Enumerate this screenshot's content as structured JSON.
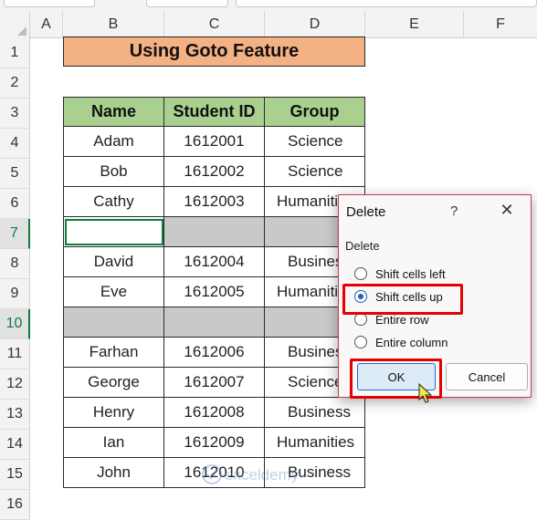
{
  "columns": [
    "A",
    "B",
    "C",
    "D",
    "E",
    "F"
  ],
  "rows": [
    "1",
    "2",
    "3",
    "4",
    "5",
    "6",
    "7",
    "8",
    "9",
    "10",
    "11",
    "12",
    "13",
    "14",
    "15",
    "16"
  ],
  "sheet": {
    "title": "Using Goto Feature",
    "headers": [
      "Name",
      "Student ID",
      "Group"
    ],
    "data_rows": [
      {
        "row": "4",
        "name": "Adam",
        "id": "1612001",
        "group": "Science"
      },
      {
        "row": "5",
        "name": "Bob",
        "id": "1612002",
        "group": "Science"
      },
      {
        "row": "6",
        "name": "Cathy",
        "id": "1612003",
        "group": "Humanities"
      },
      {
        "row": "8",
        "name": "David",
        "id": "1612004",
        "group": "Business"
      },
      {
        "row": "9",
        "name": "Eve",
        "id": "1612005",
        "group": "Humanities"
      },
      {
        "row": "11",
        "name": "Farhan",
        "id": "1612006",
        "group": "Business"
      },
      {
        "row": "12",
        "name": "George",
        "id": "1612007",
        "group": "Science"
      },
      {
        "row": "13",
        "name": "Henry",
        "id": "1612008",
        "group": "Business"
      },
      {
        "row": "14",
        "name": "Ian",
        "id": "1612009",
        "group": "Humanities"
      },
      {
        "row": "15",
        "name": "John",
        "id": "1612010",
        "group": "Business"
      }
    ],
    "selected_rows": [
      "7",
      "10"
    ]
  },
  "dialog": {
    "title": "Delete",
    "help": "?",
    "close": "✕",
    "group_label": "Delete",
    "options": [
      "Shift cells left",
      "Shift cells up",
      "Entire row",
      "Entire column"
    ],
    "selected_option": "Shift cells up",
    "ok_label": "OK",
    "cancel_label": "Cancel"
  },
  "watermark": "exceldemy",
  "colors": {
    "accent": "#107c41",
    "title_fill": "#f4b183",
    "header_fill": "#a9d08e",
    "highlight": "#e60000"
  }
}
